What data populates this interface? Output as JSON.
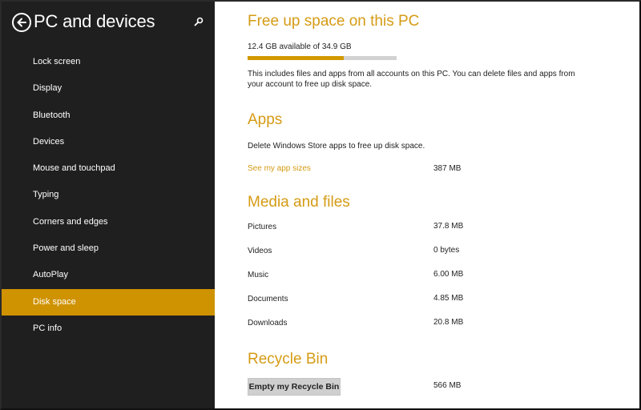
{
  "sidebar": {
    "title": "PC and devices",
    "back_icon": "back-arrow-icon",
    "search_icon": "search-icon",
    "items": [
      {
        "label": "Lock screen",
        "active": false
      },
      {
        "label": "Display",
        "active": false
      },
      {
        "label": "Bluetooth",
        "active": false
      },
      {
        "label": "Devices",
        "active": false
      },
      {
        "label": "Mouse and touchpad",
        "active": false
      },
      {
        "label": "Typing",
        "active": false
      },
      {
        "label": "Corners and edges",
        "active": false
      },
      {
        "label": "Power and sleep",
        "active": false
      },
      {
        "label": "AutoPlay",
        "active": false
      },
      {
        "label": "Disk space",
        "active": true
      },
      {
        "label": "PC info",
        "active": false
      }
    ]
  },
  "main": {
    "title": "Free up space on this PC",
    "storage_summary": "12.4 GB available of 34.9 GB",
    "storage_used_fraction": 0.645,
    "description_line1": "This includes files and apps from all accounts on this PC. You can delete files and apps from",
    "description_line2": "your account to free up disk space.",
    "apps": {
      "heading": "Apps",
      "description": "Delete Windows Store apps to free up disk space.",
      "link_label": "See my app sizes",
      "size": "387 MB"
    },
    "media": {
      "heading": "Media and files",
      "rows": [
        {
          "label": "Pictures",
          "size": "37.8 MB"
        },
        {
          "label": "Videos",
          "size": "0 bytes"
        },
        {
          "label": "Music",
          "size": "6.00 MB"
        },
        {
          "label": "Documents",
          "size": "4.85 MB"
        },
        {
          "label": "Downloads",
          "size": "20.8 MB"
        }
      ]
    },
    "recycle": {
      "heading": "Recycle Bin",
      "button_label": "Empty my Recycle Bin",
      "size": "566 MB"
    }
  },
  "colors": {
    "accent": "#cf9200",
    "heading": "#d59b14",
    "sidebar_bg": "#1f1f1f",
    "progress_track": "#d2d2d2"
  }
}
